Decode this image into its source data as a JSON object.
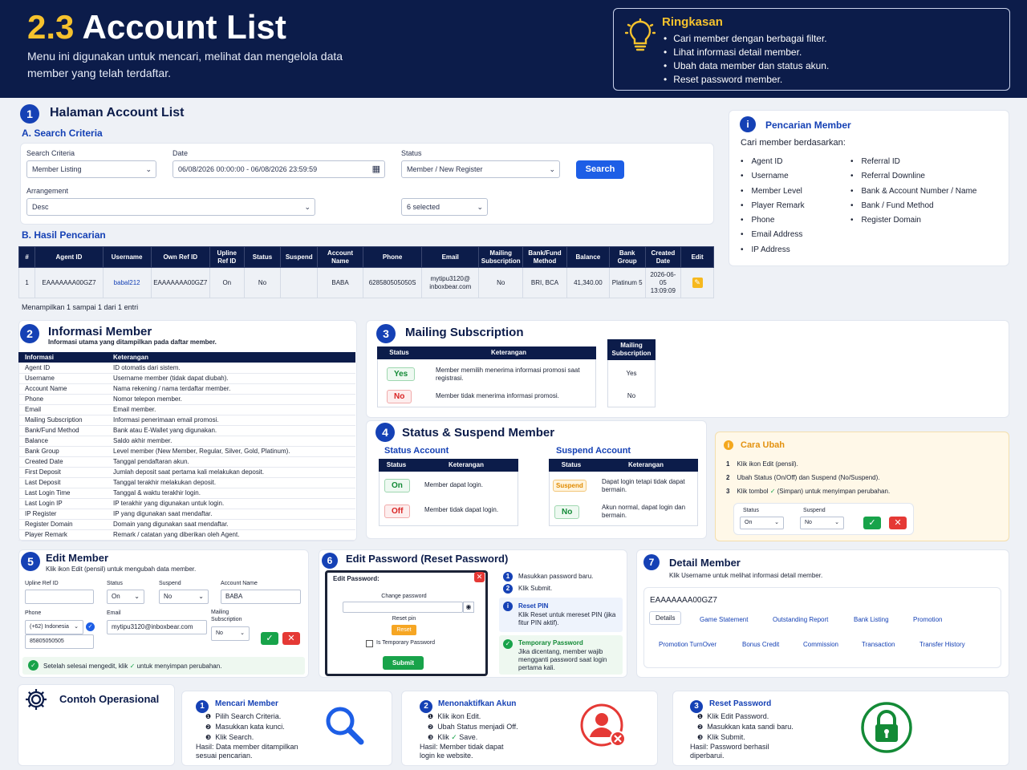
{
  "header": {
    "num": "2.3",
    "title": "Account List",
    "desc": "Menu ini digunakan untuk mencari, melihat dan mengelola data member yang telah terdaftar."
  },
  "summary": {
    "title": "Ringkasan",
    "items": [
      "Cari member dengan berbagai filter.",
      "Lihat informasi detail member.",
      "Ubah data member dan status akun.",
      "Reset password member."
    ]
  },
  "s1": {
    "num": "1",
    "title": "Halaman Account List",
    "a": "A.  Search Criteria",
    "b": "B.  Hasil Pencarian",
    "search_criteria_label": "Search Criteria",
    "search_criteria_value": "Member Listing",
    "date_label": "Date",
    "date_value": "06/08/2026 00:00:00   -   06/08/2026 23:59:59",
    "status_label": "Status",
    "status_value": "Member / New Register",
    "search_btn": "Search",
    "arrangement_label": "Arrangement",
    "arrangement_value": "Desc",
    "selected_value": "6 selected",
    "columns": [
      "#",
      "Agent ID",
      "Username",
      "Own Ref ID",
      "Upline Ref ID",
      "Status",
      "Suspend",
      "Account Name",
      "Phone",
      "Email",
      "Mailing Subscription",
      "Bank/Fund Method",
      "Balance",
      "Bank Group",
      "Created Date",
      "Edit"
    ],
    "row": [
      "1",
      "EAAAAAAA00GZ7",
      "babal212",
      "EAAAAAAA00GZ7",
      "On",
      "No",
      "",
      "BABA",
      "628580505050S",
      "mytipu3120@ inboxbear.com",
      "No",
      "BRI, BCA",
      "41,340.00",
      "Platinum 5",
      "2026-06-05 13:09:09"
    ],
    "footer": "Menampilkan 1 sampai 1 dari 1 entri"
  },
  "search_side": {
    "title": "Pencarian Member",
    "intro": "Cari member berdasarkan:",
    "left": [
      "Agent ID",
      "Username",
      "Member Level",
      "Player Remark",
      "Phone",
      "Email Address",
      "IP Address"
    ],
    "right": [
      "Referral ID",
      "Referral Downline",
      "Bank & Account Number / Name",
      "Bank / Fund Method",
      "Register Domain"
    ]
  },
  "s2": {
    "num": "2",
    "title": "Informasi Member",
    "subtitle": "Informasi utama yang ditampilkan pada daftar member.",
    "col1": "Informasi",
    "col2": "Keterangan",
    "rows": [
      [
        "Agent ID",
        "ID otomatis dari sistem."
      ],
      [
        "Username",
        "Username member (tidak dapat diubah)."
      ],
      [
        "Account Name",
        "Nama rekening / nama terdaftar member."
      ],
      [
        "Phone",
        "Nomor telepon member."
      ],
      [
        "Email",
        "Email member."
      ],
      [
        "Mailing Subscription",
        "Informasi penerimaan email promosi."
      ],
      [
        "Bank/Fund Method",
        "Bank atau E-Wallet yang digunakan."
      ],
      [
        "Balance",
        "Saldo akhir member."
      ],
      [
        "Bank Group",
        "Level member (New Member, Regular, Silver, Gold, Platinum)."
      ],
      [
        "Created Date",
        "Tanggal pendaftaran akun."
      ],
      [
        "First Deposit",
        "Jumlah deposit saat pertama kali melakukan deposit."
      ],
      [
        "Last Deposit",
        "Tanggal terakhir melakukan deposit."
      ],
      [
        "Last Login Time",
        "Tanggal & waktu terakhir login."
      ],
      [
        "Last Login IP",
        "IP terakhir yang digunakan untuk login."
      ],
      [
        "IP Register",
        "IP yang digunakan saat mendaftar."
      ],
      [
        "Register Domain",
        "Domain yang digunakan saat mendaftar."
      ],
      [
        "Player Remark",
        "Remark / catatan yang diberikan oleh Agent."
      ]
    ]
  },
  "s3": {
    "num": "3",
    "title": "Mailing Subscription",
    "col1": "Status",
    "col2": "Keterangan",
    "col3": "Mailing Subscription",
    "yes": "Yes",
    "yes_desc": "Member memilih menerima informasi promosi saat registrasi.",
    "no": "No",
    "no_desc": "Member tidak menerima informasi promosi.",
    "yes_val": "Yes",
    "no_val": "No"
  },
  "s4": {
    "num": "4",
    "title": "Status & Suspend Member",
    "status_title": "Status Account",
    "suspend_title": "Suspend Account",
    "col1": "Status",
    "col2": "Keterangan",
    "on": "On",
    "on_desc": "Member dapat login.",
    "off": "Off",
    "off_desc": "Member tidak dapat login.",
    "suspend": "Suspend",
    "suspend_desc": "Dapat login tetapi tidak dapat bermain.",
    "no": "No",
    "no_desc": "Akun normal, dapat login dan bermain."
  },
  "cara": {
    "title": "Cara Ubah",
    "step1": "Klik ikon Edit (pensil).",
    "step2": "Ubah Status (On/Off) dan Suspend (No/Suspend).",
    "step3a": "Klik tombol",
    "step3b": "(Simpan) untuk menyimpan perubahan.",
    "status_label": "Status",
    "status_value": "On",
    "suspend_label": "Suspend",
    "suspend_value": "No"
  },
  "s5": {
    "num": "5",
    "title": "Edit Member",
    "subtitle": "Klik ikon Edit (pensil) untuk mengubah data member.",
    "upline_label": "Upline Ref ID",
    "status_label": "Status",
    "status_value": "On",
    "suspend_label": "Suspend",
    "suspend_value": "No",
    "account_label": "Account Name",
    "account_value": "BABA",
    "phone_label": "Phone",
    "phone_code": "(+62) Indonesia",
    "phone_value": "85805050505",
    "email_label": "Email",
    "email_value": "mytipu3120@inboxbear.com",
    "mailing_label": "Mailing Subscription",
    "mailing_value": "No",
    "note_a": "Setelah selesai mengedit, klik",
    "note_b": "untuk menyimpan perubahan."
  },
  "s6": {
    "num": "6",
    "title": "Edit Password (Reset Password)",
    "dlg_title": "Edit Password:",
    "change_label": "Change password",
    "reset_label": "Reset pin",
    "reset_btn": "Reset",
    "temp_label": "Is Temporary Password",
    "submit_btn": "Submit",
    "step1": "Masukkan password baru.",
    "step2": "Klik Submit.",
    "pin_title": "Reset PIN",
    "pin_desc": "Klik Reset untuk mereset PIN (jika fitur PIN aktif).",
    "temp_title": "Temporary Password",
    "temp_desc": "Jika dicentang, member wajib mengganti password saat login pertama kali."
  },
  "s7": {
    "num": "7",
    "title": "Detail Member",
    "subtitle": "Klik Username untuk melihat informasi detail member.",
    "agent": "EAAAAAAA00GZ7",
    "tabs1": [
      "Details",
      "Game Statement",
      "Outstanding Report",
      "Bank Listing",
      "Promotion"
    ],
    "tabs2": [
      "Promotion TurnOver",
      "Bonus Credit",
      "Commission",
      "Transaction",
      "Transfer History"
    ]
  },
  "contoh": {
    "title": "Contoh Operasional",
    "c1": {
      "num": "1",
      "title": "Mencari Member",
      "steps": [
        "Pilih Search Criteria.",
        "Masukkan kata kunci.",
        "Klik Search."
      ],
      "result": "Hasil: Data member ditampilkan sesuai pencarian."
    },
    "c2": {
      "num": "2",
      "title": "Menonaktifkan Akun",
      "steps": [
        "Klik ikon Edit.",
        "Ubah Status menjadi Off.",
        "Save."
      ],
      "step3_pre": "Klik",
      "result": "Hasil: Member tidak dapat login ke website."
    },
    "c3": {
      "num": "3",
      "title": "Reset Password",
      "steps": [
        "Klik Edit Password.",
        "Masukkan kata sandi baru.",
        "Klik Submit."
      ],
      "result": "Hasil: Password berhasil diperbarui."
    }
  },
  "colors": {
    "navy": "#0c1c4a",
    "accent": "#1541b5",
    "yellow": "#f6c22d",
    "green": "#18a34a",
    "red": "#e53935"
  }
}
